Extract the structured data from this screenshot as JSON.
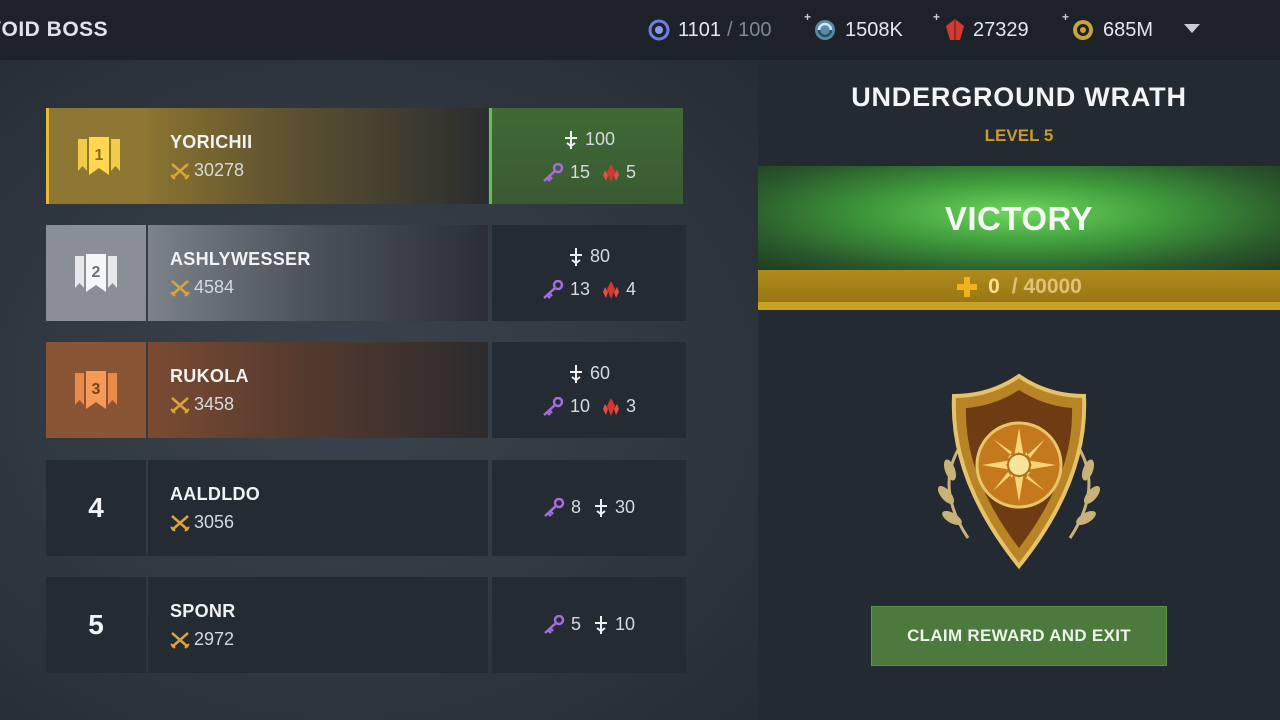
{
  "header": {
    "title": "VOID BOSS",
    "resources": [
      {
        "name": "energy",
        "value": "1101",
        "sub": "/ 100"
      },
      {
        "name": "silver",
        "value": "1508K"
      },
      {
        "name": "gems",
        "value": "27329"
      },
      {
        "name": "gold",
        "value": "685M"
      }
    ]
  },
  "leaderboard": [
    {
      "rank": "1",
      "name": "YORICHII",
      "score": "30278",
      "attack": "100",
      "keys": "15",
      "crystals": "5"
    },
    {
      "rank": "2",
      "name": "ASHLYWESSER",
      "score": "4584",
      "attack": "80",
      "keys": "13",
      "crystals": "4"
    },
    {
      "rank": "3",
      "name": "RUKOLA",
      "score": "3458",
      "attack": "60",
      "keys": "10",
      "crystals": "3"
    },
    {
      "rank": "4",
      "name": "AALDLDO",
      "score": "3056",
      "keys": "8",
      "attack": "30"
    },
    {
      "rank": "5",
      "name": "SPONR",
      "score": "2972",
      "keys": "5",
      "attack": "10"
    }
  ],
  "boss": {
    "name": "UNDERGROUND WRATH",
    "level": "LEVEL 5",
    "result": "VICTORY",
    "progress_current": "0",
    "progress_max": "/ 40000"
  },
  "actions": {
    "claim_label": "CLAIM REWARD AND EXIT"
  },
  "colors": {
    "gold_accent": "#c99b32",
    "victory_green": "#3e9a3b",
    "claim_button": "#4c7a3c"
  }
}
